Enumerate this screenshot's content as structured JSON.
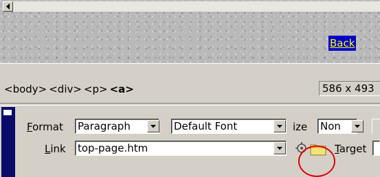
{
  "canvas": {
    "link_text": "Back"
  },
  "status_bar": {
    "tags": [
      "<body>",
      "<div>",
      "<p>",
      "<a>"
    ],
    "window_size": "586 x 493"
  },
  "inspector": {
    "format_label_mnemonic": "F",
    "format_label_rest": "ormat",
    "format_value": "Paragraph",
    "font_value": "Default Font",
    "size_label": "ize",
    "size_value": "Non",
    "link_label_mnemonic": "L",
    "link_label_rest": "ink",
    "link_value": "top-page.htm",
    "target_label_mnemonic": "T",
    "target_label_rest": "arget"
  },
  "colors": {
    "link_background": "#0000cc",
    "link_text": "#ffff00",
    "highlight_circle": "#e00000",
    "panel_grip": "#0a0a6a"
  },
  "icons": [
    "scroll-left-arrow-icon",
    "chevron-down-icon",
    "point-to-file-icon",
    "folder-icon"
  ]
}
